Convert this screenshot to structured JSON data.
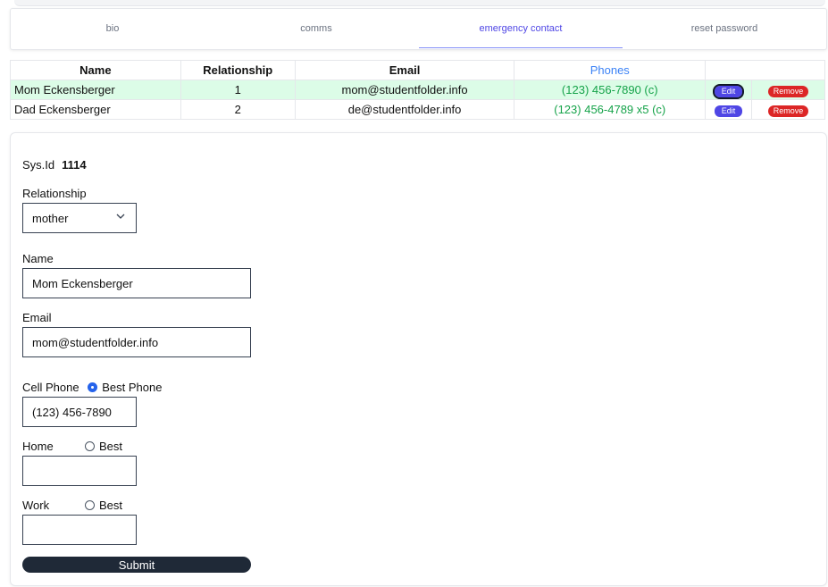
{
  "tabs": [
    {
      "label": "bio"
    },
    {
      "label": "comms"
    },
    {
      "label": "emergency contact"
    },
    {
      "label": "reset password"
    }
  ],
  "active_tab": "emergency contact",
  "table": {
    "headers": [
      "Name",
      "Relationship",
      "Email",
      "Phones"
    ],
    "rows": [
      {
        "name": "Mom Eckensberger",
        "relationship": "1",
        "email": "mom@studentfolder.info",
        "phones": "(123) 456-7890 (c)",
        "edit": "Edit",
        "remove": "Remove"
      },
      {
        "name": "Dad Eckensberger",
        "relationship": "2",
        "email": "de@studentfolder.info",
        "phones": "(123) 456-4789 x5 (c)",
        "edit": "Edit",
        "remove": "Remove"
      }
    ]
  },
  "form": {
    "sysid_label": "Sys.Id",
    "sysid_value": "1114",
    "relationship_label": "Relationship",
    "relationship_value": "mother",
    "name_label": "Name",
    "name_value": "Mom Eckensberger",
    "email_label": "Email",
    "email_value": "mom@studentfolder.info",
    "cell_label": "Cell Phone",
    "cell_best_label": "Best Phone",
    "cell_value": "(123) 456-7890",
    "home_label": "Home",
    "home_best_label": "Best",
    "home_value": "",
    "work_label": "Work",
    "work_best_label": "Best",
    "work_value": "",
    "submit_label": "Submit"
  },
  "colors": {
    "accent": "#4f46e5",
    "selected_row": "#dcfce7",
    "phone_text": "#16a34a",
    "remove": "#dc2626",
    "submit": "#1f2937"
  },
  "icons": {
    "select": "chevron-down-icon"
  }
}
